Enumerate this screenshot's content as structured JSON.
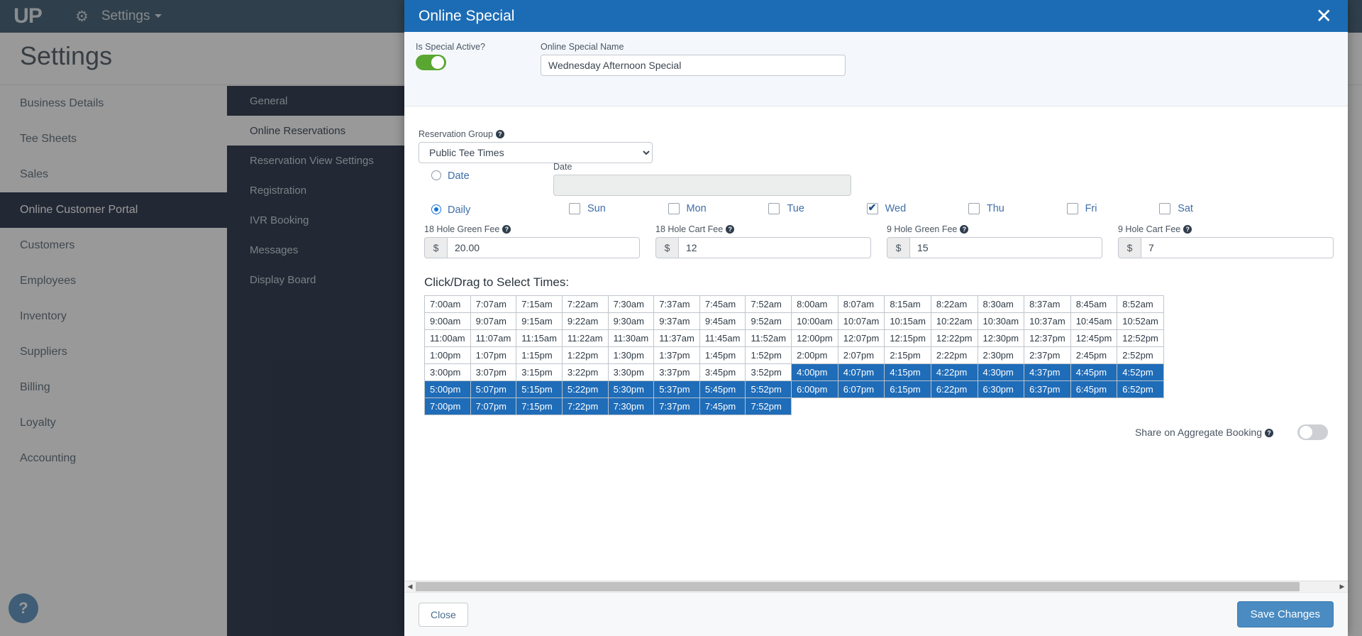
{
  "topbar": {
    "logo": "UP",
    "gear_icon": "gear-icon",
    "settings_label": "Settings"
  },
  "page": {
    "title": "Settings"
  },
  "primary_nav": {
    "items": [
      {
        "label": "Business Details",
        "active": false
      },
      {
        "label": "Tee Sheets",
        "active": false
      },
      {
        "label": "Sales",
        "active": false
      },
      {
        "label": "Online Customer Portal",
        "active": true
      },
      {
        "label": "Customers",
        "active": false
      },
      {
        "label": "Employees",
        "active": false
      },
      {
        "label": "Inventory",
        "active": false
      },
      {
        "label": "Suppliers",
        "active": false
      },
      {
        "label": "Billing",
        "active": false
      },
      {
        "label": "Loyalty",
        "active": false
      },
      {
        "label": "Accounting",
        "active": false
      }
    ]
  },
  "secondary_nav": {
    "items": [
      {
        "label": "General",
        "active": false
      },
      {
        "label": "Online Reservations",
        "active": true
      },
      {
        "label": "Reservation View Settings",
        "active": false
      },
      {
        "label": "Registration",
        "active": false
      },
      {
        "label": "IVR Booking",
        "active": false
      },
      {
        "label": "Messages",
        "active": false
      },
      {
        "label": "Display Board",
        "active": false
      }
    ]
  },
  "help_fab": {
    "glyph": "?"
  },
  "modal": {
    "title": "Online Special",
    "close_icon": "✕",
    "is_special_active": {
      "label": "Is Special Active?",
      "value": true
    },
    "special_name": {
      "label": "Online Special Name",
      "value": "Wednesday Afternoon Special",
      "placeholder": ""
    },
    "reservation_group": {
      "label": "Reservation Group",
      "hint": "?",
      "selected": "Public Tee Times",
      "options": [
        "Public Tee Times"
      ]
    },
    "schedule": {
      "date_radio_label": "Date",
      "date_radio_selected": false,
      "daily_radio_label": "Daily",
      "daily_radio_selected": true,
      "date_field_label": "Date",
      "date_field_value": "",
      "days": [
        {
          "label": "Sun",
          "checked": false
        },
        {
          "label": "Mon",
          "checked": false
        },
        {
          "label": "Tue",
          "checked": false
        },
        {
          "label": "Wed",
          "checked": true
        },
        {
          "label": "Thu",
          "checked": false
        },
        {
          "label": "Fri",
          "checked": false
        },
        {
          "label": "Sat",
          "checked": false
        }
      ]
    },
    "fees": [
      {
        "label": "18 Hole Green Fee",
        "hint": "?",
        "currency": "$",
        "value": "20.00"
      },
      {
        "label": "18 Hole Cart Fee",
        "hint": "?",
        "currency": "$",
        "value": "12"
      },
      {
        "label": "9 Hole Green Fee",
        "hint": "?",
        "currency": "$",
        "value": "15"
      },
      {
        "label": "9 Hole Cart Fee",
        "hint": "?",
        "currency": "$",
        "value": "7"
      }
    ],
    "times": {
      "heading": "Click/Drag to Select Times:",
      "rows": [
        {
          "cells": [
            {
              "t": "7:00am",
              "s": false
            },
            {
              "t": "7:07am",
              "s": false
            },
            {
              "t": "7:15am",
              "s": false
            },
            {
              "t": "7:22am",
              "s": false
            },
            {
              "t": "7:30am",
              "s": false
            },
            {
              "t": "7:37am",
              "s": false
            },
            {
              "t": "7:45am",
              "s": false
            },
            {
              "t": "7:52am",
              "s": false
            },
            {
              "t": "8:00am",
              "s": false
            },
            {
              "t": "8:07am",
              "s": false
            },
            {
              "t": "8:15am",
              "s": false
            },
            {
              "t": "8:22am",
              "s": false
            },
            {
              "t": "8:30am",
              "s": false
            },
            {
              "t": "8:37am",
              "s": false
            },
            {
              "t": "8:45am",
              "s": false
            },
            {
              "t": "8:52am",
              "s": false
            }
          ]
        },
        {
          "cells": [
            {
              "t": "9:00am",
              "s": false
            },
            {
              "t": "9:07am",
              "s": false
            },
            {
              "t": "9:15am",
              "s": false
            },
            {
              "t": "9:22am",
              "s": false
            },
            {
              "t": "9:30am",
              "s": false
            },
            {
              "t": "9:37am",
              "s": false
            },
            {
              "t": "9:45am",
              "s": false
            },
            {
              "t": "9:52am",
              "s": false
            },
            {
              "t": "10:00am",
              "s": false
            },
            {
              "t": "10:07am",
              "s": false
            },
            {
              "t": "10:15am",
              "s": false
            },
            {
              "t": "10:22am",
              "s": false
            },
            {
              "t": "10:30am",
              "s": false
            },
            {
              "t": "10:37am",
              "s": false
            },
            {
              "t": "10:45am",
              "s": false
            },
            {
              "t": "10:52am",
              "s": false
            }
          ]
        },
        {
          "cells": [
            {
              "t": "11:00am",
              "s": false
            },
            {
              "t": "11:07am",
              "s": false
            },
            {
              "t": "11:15am",
              "s": false
            },
            {
              "t": "11:22am",
              "s": false
            },
            {
              "t": "11:30am",
              "s": false
            },
            {
              "t": "11:37am",
              "s": false
            },
            {
              "t": "11:45am",
              "s": false
            },
            {
              "t": "11:52am",
              "s": false
            },
            {
              "t": "12:00pm",
              "s": false
            },
            {
              "t": "12:07pm",
              "s": false
            },
            {
              "t": "12:15pm",
              "s": false
            },
            {
              "t": "12:22pm",
              "s": false
            },
            {
              "t": "12:30pm",
              "s": false
            },
            {
              "t": "12:37pm",
              "s": false
            },
            {
              "t": "12:45pm",
              "s": false
            },
            {
              "t": "12:52pm",
              "s": false
            }
          ]
        },
        {
          "cells": [
            {
              "t": "1:00pm",
              "s": false
            },
            {
              "t": "1:07pm",
              "s": false
            },
            {
              "t": "1:15pm",
              "s": false
            },
            {
              "t": "1:22pm",
              "s": false
            },
            {
              "t": "1:30pm",
              "s": false
            },
            {
              "t": "1:37pm",
              "s": false
            },
            {
              "t": "1:45pm",
              "s": false
            },
            {
              "t": "1:52pm",
              "s": false
            },
            {
              "t": "2:00pm",
              "s": false
            },
            {
              "t": "2:07pm",
              "s": false
            },
            {
              "t": "2:15pm",
              "s": false
            },
            {
              "t": "2:22pm",
              "s": false
            },
            {
              "t": "2:30pm",
              "s": false
            },
            {
              "t": "2:37pm",
              "s": false
            },
            {
              "t": "2:45pm",
              "s": false
            },
            {
              "t": "2:52pm",
              "s": false
            }
          ]
        },
        {
          "cells": [
            {
              "t": "3:00pm",
              "s": false
            },
            {
              "t": "3:07pm",
              "s": false
            },
            {
              "t": "3:15pm",
              "s": false
            },
            {
              "t": "3:22pm",
              "s": false
            },
            {
              "t": "3:30pm",
              "s": false
            },
            {
              "t": "3:37pm",
              "s": false
            },
            {
              "t": "3:45pm",
              "s": false
            },
            {
              "t": "3:52pm",
              "s": false
            },
            {
              "t": "4:00pm",
              "s": true
            },
            {
              "t": "4:07pm",
              "s": true
            },
            {
              "t": "4:15pm",
              "s": true
            },
            {
              "t": "4:22pm",
              "s": true
            },
            {
              "t": "4:30pm",
              "s": true
            },
            {
              "t": "4:37pm",
              "s": true
            },
            {
              "t": "4:45pm",
              "s": true
            },
            {
              "t": "4:52pm",
              "s": true
            }
          ]
        },
        {
          "cells": [
            {
              "t": "5:00pm",
              "s": true
            },
            {
              "t": "5:07pm",
              "s": true
            },
            {
              "t": "5:15pm",
              "s": true
            },
            {
              "t": "5:22pm",
              "s": true
            },
            {
              "t": "5:30pm",
              "s": true
            },
            {
              "t": "5:37pm",
              "s": true
            },
            {
              "t": "5:45pm",
              "s": true
            },
            {
              "t": "5:52pm",
              "s": true
            },
            {
              "t": "6:00pm",
              "s": true
            },
            {
              "t": "6:07pm",
              "s": true
            },
            {
              "t": "6:15pm",
              "s": true
            },
            {
              "t": "6:22pm",
              "s": true
            },
            {
              "t": "6:30pm",
              "s": true
            },
            {
              "t": "6:37pm",
              "s": true
            },
            {
              "t": "6:45pm",
              "s": true
            },
            {
              "t": "6:52pm",
              "s": true
            }
          ]
        },
        {
          "cells": [
            {
              "t": "7:00pm",
              "s": true
            },
            {
              "t": "7:07pm",
              "s": true
            },
            {
              "t": "7:15pm",
              "s": true
            },
            {
              "t": "7:22pm",
              "s": true
            },
            {
              "t": "7:30pm",
              "s": true
            },
            {
              "t": "7:37pm",
              "s": true
            },
            {
              "t": "7:45pm",
              "s": true
            },
            {
              "t": "7:52pm",
              "s": true
            }
          ]
        }
      ]
    },
    "share_aggregate": {
      "label": "Share on Aggregate Booking",
      "hint": "?",
      "value": false
    },
    "footer": {
      "close_label": "Close",
      "save_label": "Save Changes"
    }
  },
  "colors": {
    "topbar": "#2b4b63",
    "nav_dark": "#111c34",
    "modal_header": "#1c6cb5",
    "selected_time": "#1f6cb8",
    "toggle_on": "#5aa632",
    "save_button": "#4a8bc2",
    "link_text": "#3f6ea8"
  }
}
